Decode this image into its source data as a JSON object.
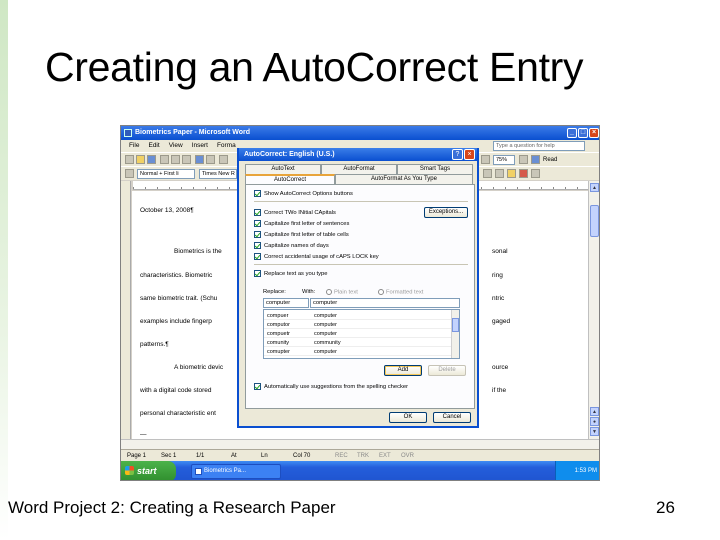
{
  "slide": {
    "title": "Creating an AutoCorrect Entry",
    "footer": "Word Project 2: Creating a Research Paper",
    "page_number": "26"
  },
  "word": {
    "title": "Biometrics Paper - Microsoft Word",
    "menus": [
      "File",
      "Edit",
      "View",
      "Insert",
      "Forma"
    ],
    "help_placeholder": "Type a question for help",
    "style_box": "Normal + First li",
    "font_box": "Times New R",
    "zoom": "75%",
    "read_label": "Read",
    "doc_lines": [
      "October 13, 2008¶",
      "Biometrics is the",
      "characteristics. Biometric",
      "same biometric trait. (Schu",
      "examples include fingerp",
      "patterns.¶",
      "A biometric devic",
      "with a digital code stored",
      "personal characteristic ent",
      "—"
    ],
    "doc_lines_right": [
      "sonal",
      "ring",
      "ntric",
      "gaged",
      "ource",
      "if the"
    ],
    "status": {
      "page": "Page 1",
      "sec": "Sec 1",
      "fraction": "1/1",
      "at": "At",
      "ln": "Ln",
      "col": "Col 70",
      "modes": [
        "REC",
        "TRK",
        "EXT",
        "OVR"
      ]
    },
    "taskbar": {
      "start": "start",
      "task": "Biometrics Pa...",
      "clock": "1:53 PM"
    }
  },
  "dialog": {
    "title": "AutoCorrect: English (U.S.)",
    "tabs_row1": [
      "AutoText",
      "AutoFormat",
      "Smart Tags"
    ],
    "tabs_row2": [
      "AutoCorrect",
      "AutoFormat As You Type"
    ],
    "options": [
      {
        "label": "Show AutoCorrect Options buttons",
        "checked": true
      },
      {
        "label": "Correct TWo INitial CApitals",
        "checked": true
      },
      {
        "label": "Capitalize first letter of sentences",
        "checked": true
      },
      {
        "label": "Capitalize first letter of table cells",
        "checked": true
      },
      {
        "label": "Capitalize names of days",
        "checked": true
      },
      {
        "label": "Correct accidental usage of cAPS LOCK key",
        "checked": true
      },
      {
        "label": "Replace text as you type",
        "checked": true
      }
    ],
    "exceptions_button": "Exceptions...",
    "replace_label": "Replace:",
    "with_label": "With:",
    "plain_text": "Plain text",
    "formatted_text": "Formatted text",
    "replace_value": "computer",
    "with_value": "computer",
    "entries": [
      {
        "from": "compuer",
        "to": "computer"
      },
      {
        "from": "computor",
        "to": "computer"
      },
      {
        "from": "compuetr",
        "to": "computer"
      },
      {
        "from": "comunity",
        "to": "community"
      },
      {
        "from": "comupter",
        "to": "computer"
      }
    ],
    "add_button": "Add",
    "delete_button": "Delete",
    "suggestions": {
      "label": "Automatically use suggestions from the spelling checker",
      "checked": true
    },
    "ok_button": "OK",
    "cancel_button": "Cancel"
  },
  "colors": {
    "xp_blue": "#0a4fd0",
    "xp_green": "#2f8d2d",
    "dialog_face": "#ece9d8"
  }
}
